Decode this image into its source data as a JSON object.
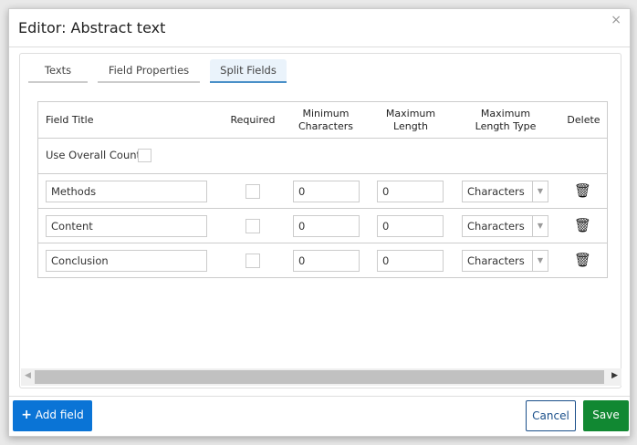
{
  "dialog": {
    "title": "Editor: Abstract text",
    "close": "×"
  },
  "tabs": [
    {
      "label": "Texts"
    },
    {
      "label": "Field Properties"
    },
    {
      "label": "Split Fields",
      "active": true
    }
  ],
  "table": {
    "headers": {
      "field_title": "Field Title",
      "required": "Required",
      "min_l1": "Minimum",
      "min_l2": "Characters",
      "max_l1": "Maximum",
      "max_l2": "Length",
      "type_l1": "Maximum",
      "type_l2": "Length Type",
      "delete": "Delete"
    },
    "overall_count_label": "Use Overall Count",
    "rows": [
      {
        "title": "Methods",
        "required": false,
        "min": "0",
        "max": "0",
        "type": "Characters"
      },
      {
        "title": "Content",
        "required": false,
        "min": "0",
        "max": "0",
        "type": "Characters"
      },
      {
        "title": "Conclusion",
        "required": false,
        "min": "0",
        "max": "0",
        "type": "Characters"
      }
    ]
  },
  "footer": {
    "add_field": "Add field",
    "cancel": "Cancel",
    "save": "Save"
  },
  "colors": {
    "primary": "#0a74d6",
    "save": "#118832"
  }
}
